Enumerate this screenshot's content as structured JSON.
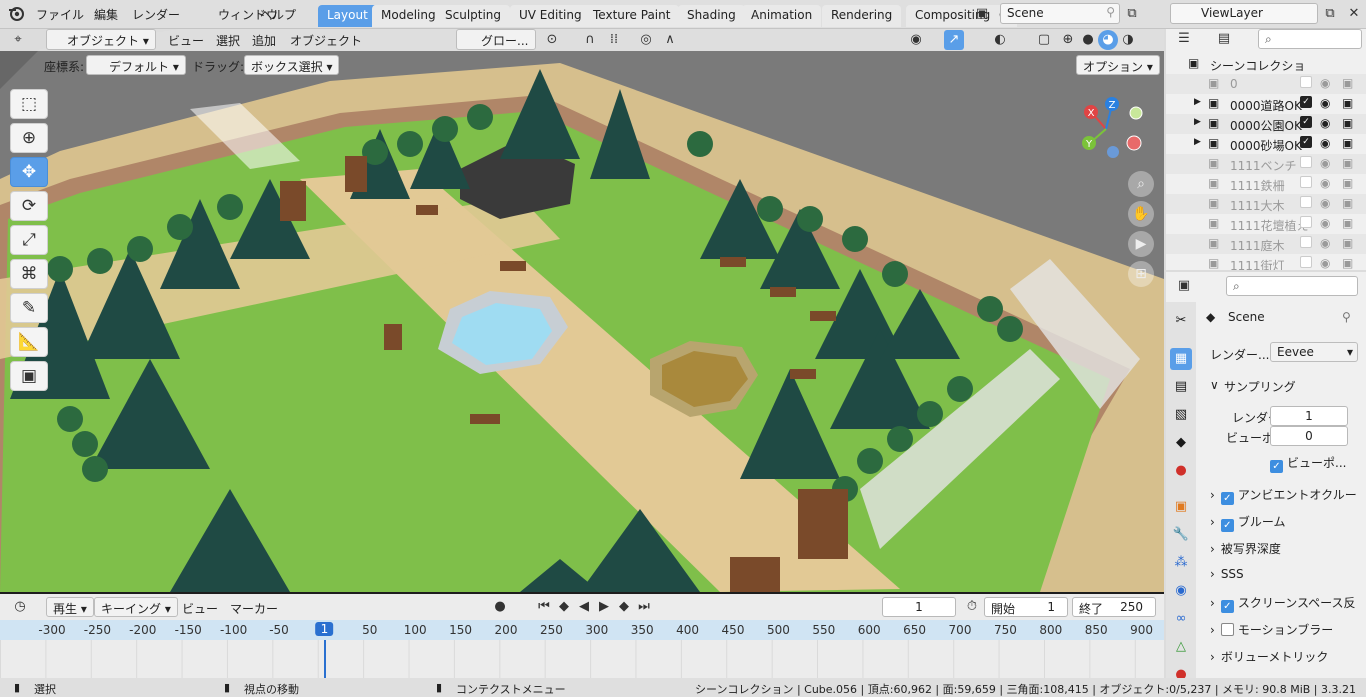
{
  "menu": {
    "file": "ファイル",
    "edit": "編集",
    "render": "レンダー",
    "window": "ウィンドウ",
    "help": "ヘルプ"
  },
  "workspaces": [
    "Layout",
    "Modeling",
    "Sculpting",
    "UV Editing",
    "Texture Paint",
    "Shading",
    "Animation",
    "Rendering",
    "Compositing",
    "G"
  ],
  "scene_name": "Scene",
  "view_layer": "ViewLayer",
  "viewport_header": {
    "mode": "オブジェクト",
    "view": "ビュー",
    "select": "選択",
    "add": "追加",
    "object": "オブジェクト",
    "transform": "グロー..."
  },
  "tool_settings": {
    "coord_label": "座標系:",
    "coord_value": "デフォルト",
    "drag_label": "ドラッグ:",
    "drag_value": "ボックス選択",
    "options": "オプション"
  },
  "gizmo": {
    "x": "X",
    "y": "Y",
    "z": "Z"
  },
  "outliner": {
    "root": "シーンコレクショ",
    "items": [
      {
        "name": "0",
        "dim": true,
        "expand": false,
        "checked": false
      },
      {
        "name": "0000道路OK",
        "dim": false,
        "expand": true,
        "checked": true
      },
      {
        "name": "0000公園OK",
        "dim": false,
        "expand": true,
        "checked": true
      },
      {
        "name": "0000砂場OK",
        "dim": false,
        "expand": true,
        "checked": true
      },
      {
        "name": "1111ベンチ",
        "dim": true,
        "expand": false,
        "checked": false
      },
      {
        "name": "1111鉄柵",
        "dim": true,
        "expand": false,
        "checked": false
      },
      {
        "name": "1111大木",
        "dim": true,
        "expand": false,
        "checked": false
      },
      {
        "name": "1111花壇植え",
        "dim": true,
        "expand": false,
        "checked": false
      },
      {
        "name": "1111庭木",
        "dim": true,
        "expand": false,
        "checked": false
      },
      {
        "name": "1111街灯",
        "dim": true,
        "expand": false,
        "checked": false
      }
    ]
  },
  "properties": {
    "scene": "Scene",
    "render_engine_label": "レンダー...",
    "render_engine": "Eevee",
    "sampling": "サンプリング",
    "render_label": "レンダー",
    "render_samples": "1",
    "viewport_label": "ビューポ...",
    "viewport_samples": "0",
    "viewport_denoise": "ビューポ...",
    "sections": [
      {
        "label": "アンビエントオクルー",
        "check": true
      },
      {
        "label": "ブルーム",
        "check": true
      },
      {
        "label": "被写界深度",
        "check": null
      },
      {
        "label": "SSS",
        "check": null
      },
      {
        "label": "スクリーンスペース反",
        "check": true
      },
      {
        "label": "モーションブラー",
        "check": false
      },
      {
        "label": "ボリューメトリック",
        "check": null
      }
    ]
  },
  "timeline": {
    "playback": "再生",
    "keying": "キーイング",
    "view": "ビュー",
    "marker": "マーカー",
    "current_frame": "1",
    "start_label": "開始",
    "start": "1",
    "end_label": "終了",
    "end": "250",
    "ticks": [
      "-300",
      "-250",
      "-200",
      "-150",
      "-100",
      "-50",
      "1",
      "50",
      "100",
      "150",
      "200",
      "250",
      "300",
      "350",
      "400",
      "450",
      "500",
      "550",
      "600",
      "650",
      "700",
      "750",
      "800",
      "850",
      "900"
    ]
  },
  "status": {
    "select": "選択",
    "rotate": "視点の移動",
    "context": "コンテクストメニュー",
    "stats": "シーンコレクション | Cube.056 | 頂点:60,962 | 面:59,659 | 三角面:108,415 | オブジェクト:0/5,237 | メモリ: 90.8 MiB | 3.3.21"
  },
  "colors": {
    "accent": "#5a9ee8",
    "grass": "#7fbf4a",
    "tree": "#1f4a44",
    "path": "#e2c995",
    "road": "#6e6e6e",
    "water": "#9fdcf2"
  }
}
